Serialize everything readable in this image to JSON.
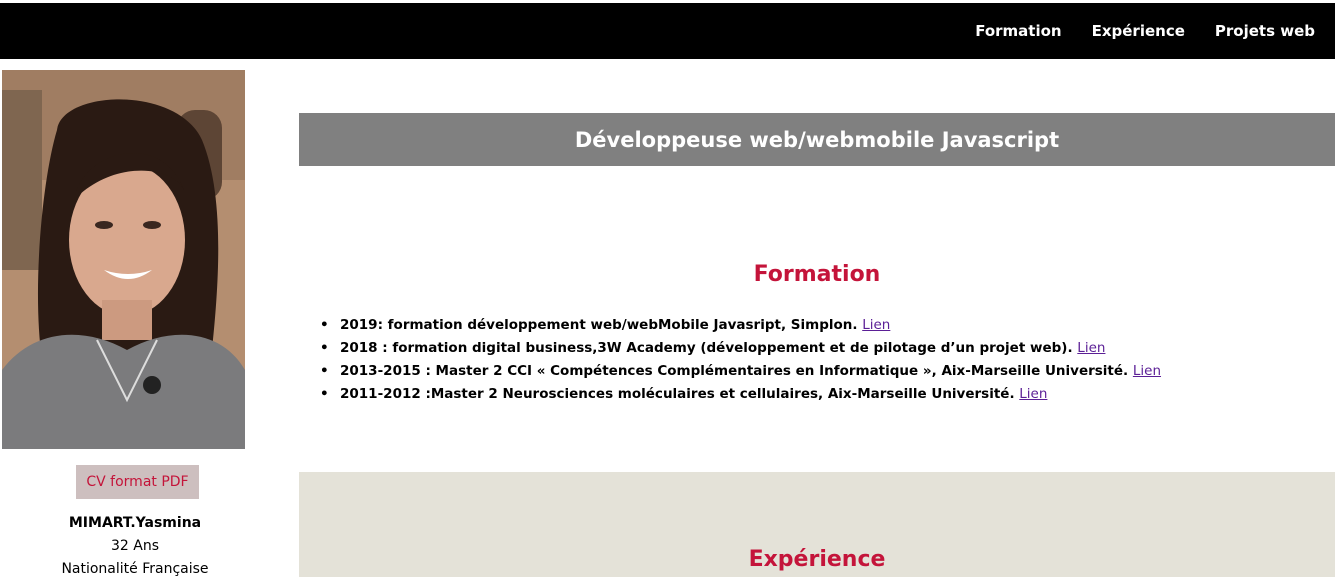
{
  "nav": {
    "items": [
      {
        "label": "Formation"
      },
      {
        "label": "Expérience"
      },
      {
        "label": "Projets web"
      }
    ]
  },
  "profile": {
    "pdf_button": "CV format PDF",
    "name": "MIMART.Yasmina",
    "age": "32 Ans",
    "nationality": "Nationalité Française"
  },
  "hero": {
    "title": "Développeuse web/webmobile Javascript"
  },
  "formation": {
    "title": "Formation",
    "items": [
      {
        "text": "2019: formation développement web/webMobile Javasript, Simplon. ",
        "link": "Lien"
      },
      {
        "text": "2018 : formation digital business,3W Academy (développement et de pilotage d’un projet web). ",
        "link": "Lien"
      },
      {
        "text": "2013-2015 : Master 2 CCI « Compétences Complémentaires en Informatique », Aix-Marseille Université. ",
        "link": "Lien"
      },
      {
        "text": "2011-2012 :Master 2 Neurosciences moléculaires et cellulaires, Aix-Marseille Université. ",
        "link": "Lien"
      }
    ]
  },
  "experience": {
    "title": "Expérience"
  },
  "colors": {
    "topbar": "#000000",
    "hero_band": "#808080",
    "accent_red": "#c4143a",
    "experience_band": "#e4e2d8",
    "link": "#5b1f96"
  }
}
